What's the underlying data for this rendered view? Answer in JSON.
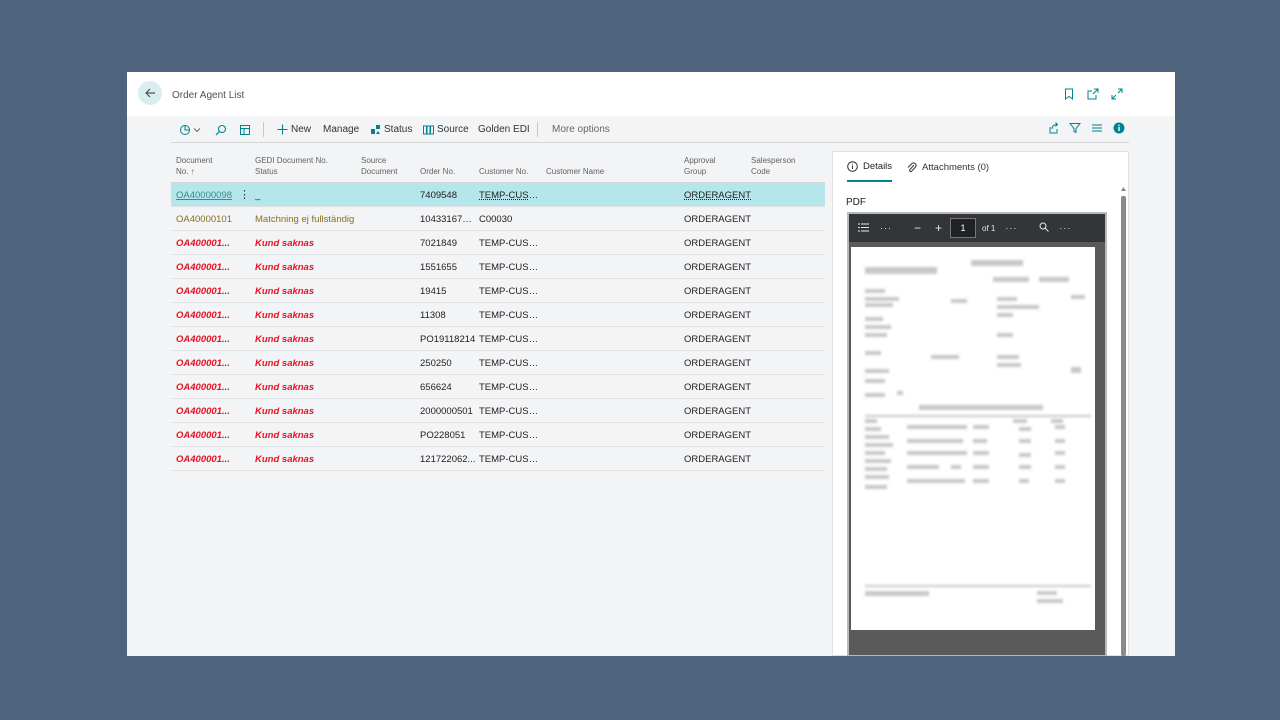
{
  "page": {
    "title": "Order Agent List"
  },
  "toolbar": {
    "new_label": "New",
    "manage_label": "Manage",
    "status_label": "Status",
    "source_label": "Source",
    "golden_edi_label": "Golden EDI",
    "more_options_label": "More options"
  },
  "columns": {
    "doc_no_1": "Document",
    "doc_no_2": "No. ↑",
    "gedi_1": "GEDI Document No.",
    "gedi_2": "Status",
    "source_1": "Source",
    "source_2": "Document",
    "order_no": "Order No.",
    "customer_no": "Customer No.",
    "customer_name": "Customer Name",
    "approval_1": "Approval",
    "approval_2": "Group",
    "salesperson_1": "Salesperson",
    "salesperson_2": "Code"
  },
  "rows": [
    {
      "doc": "OA40000098",
      "status": "_",
      "order": "7409548",
      "customer": "TEMP-CUSTO...",
      "approval": "ORDERAGENT",
      "style": "selected"
    },
    {
      "doc": "OA40000101",
      "status": "Matchning ej fullständig",
      "order": "10433167000",
      "customer": "C00030",
      "approval": "ORDERAGENT",
      "style": "warn"
    },
    {
      "doc": "OA400001...",
      "status": "Kund saknas",
      "order": "7021849",
      "customer": "TEMP-CUSTO...",
      "approval": "ORDERAGENT",
      "style": "error"
    },
    {
      "doc": "OA400001...",
      "status": "Kund saknas",
      "order": "1551655",
      "customer": "TEMP-CUSTO...",
      "approval": "ORDERAGENT",
      "style": "error"
    },
    {
      "doc": "OA400001...",
      "status": "Kund saknas",
      "order": "19415",
      "customer": "TEMP-CUSTO...",
      "approval": "ORDERAGENT",
      "style": "error"
    },
    {
      "doc": "OA400001...",
      "status": "Kund saknas",
      "order": "11308",
      "customer": "TEMP-CUSTO...",
      "approval": "ORDERAGENT",
      "style": "error"
    },
    {
      "doc": "OA400001...",
      "status": "Kund saknas",
      "order": "PO19118214",
      "customer": "TEMP-CUSTO...",
      "approval": "ORDERAGENT",
      "style": "error"
    },
    {
      "doc": "OA400001...",
      "status": "Kund saknas",
      "order": "250250",
      "customer": "TEMP-CUSTO...",
      "approval": "ORDERAGENT",
      "style": "error"
    },
    {
      "doc": "OA400001...",
      "status": "Kund saknas",
      "order": "656624",
      "customer": "TEMP-CUSTO...",
      "approval": "ORDERAGENT",
      "style": "error"
    },
    {
      "doc": "OA400001...",
      "status": "Kund saknas",
      "order": "2000000501",
      "customer": "TEMP-CUSTO...",
      "approval": "ORDERAGENT",
      "style": "error"
    },
    {
      "doc": "OA400001...",
      "status": "Kund saknas",
      "order": "PO228051",
      "customer": "TEMP-CUSTO...",
      "approval": "ORDERAGENT",
      "style": "error"
    },
    {
      "doc": "OA400001...",
      "status": "Kund saknas",
      "order": "121722062...",
      "customer": "TEMP-CUSTO...",
      "approval": "ORDERAGENT",
      "style": "error"
    }
  ],
  "factbox": {
    "details_tab": "Details",
    "attachments_tab": "Attachments (0)",
    "pdf_label": "PDF",
    "viewer": {
      "page_number": "1",
      "page_of": "of 1"
    }
  },
  "colors": {
    "accent": "#00838f",
    "selected_row": "#b4e6ec",
    "error": "#e81123",
    "warning": "#8a6d1e",
    "background": "#4e647d"
  },
  "icons": [
    "back-arrow-icon",
    "bookmark-icon",
    "open-new-window-icon",
    "expand-icon",
    "analysis-icon",
    "search-icon",
    "table-view-icon",
    "plus-icon",
    "status-icon",
    "source-icon",
    "share-icon",
    "filter-icon",
    "list-icon",
    "info-icon",
    "attachment-icon"
  ]
}
